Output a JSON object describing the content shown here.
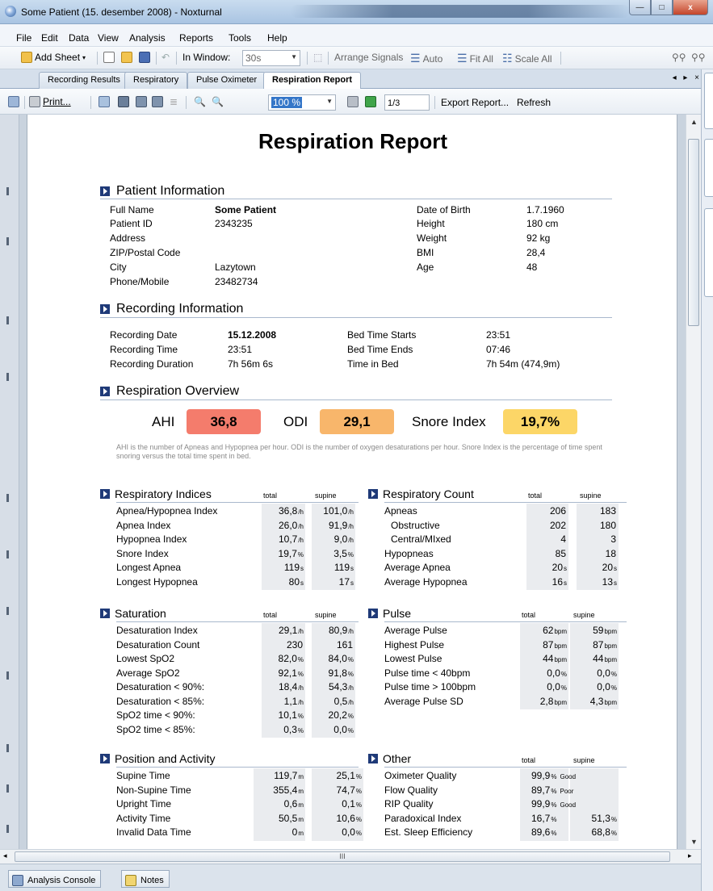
{
  "window": {
    "title": "Some Patient (15. desember 2008)  - Noxturnal",
    "min": "—",
    "max": "□",
    "close": "x"
  },
  "menu": [
    "File",
    "Edit",
    "Data",
    "View",
    "Analysis",
    "Reports",
    "Tools",
    "Help"
  ],
  "toolbar": {
    "add_sheet": "Add Sheet",
    "in_window_label": "In Window:",
    "in_window_value": "30s",
    "arrange_signals": "Arrange Signals",
    "auto": "Auto",
    "fit_all": "Fit All",
    "scale_all": "Scale All"
  },
  "tabs": [
    "Recording Results",
    "Respiratory",
    "Pulse Oximeter",
    "Respiration Report"
  ],
  "tab_controls": "◂ ▸ ×",
  "report_toolbar": {
    "print": "Print...",
    "zoom": "100 %",
    "page": "1/3",
    "export": "Export Report...",
    "refresh": "Refresh"
  },
  "report": {
    "title": "Respiration Report",
    "patient": {
      "heading": "Patient Information",
      "left": [
        {
          "label": "Full Name",
          "value": "Some Patient"
        },
        {
          "label": "Patient ID",
          "value": "2343235"
        },
        {
          "label": "Address",
          "value": ""
        },
        {
          "label": "ZIP/Postal Code",
          "value": ""
        },
        {
          "label": "City",
          "value": "Lazytown"
        },
        {
          "label": "Phone/Mobile",
          "value": "23482734"
        }
      ],
      "right": [
        {
          "label": "Date of Birth",
          "value": "1.7.1960"
        },
        {
          "label": "Height",
          "value": "180 cm"
        },
        {
          "label": "Weight",
          "value": "92 kg"
        },
        {
          "label": "BMI",
          "value": "28,4"
        },
        {
          "label": "Age",
          "value": "48"
        }
      ]
    },
    "recording": {
      "heading": "Recording Information",
      "left": [
        {
          "label": "Recording Date",
          "value": "15.12.2008"
        },
        {
          "label": "Recording Time",
          "value": "23:51"
        },
        {
          "label": "Recording Duration",
          "value": "7h 56m 6s"
        }
      ],
      "right": [
        {
          "label": "Bed Time Starts",
          "value": "23:51"
        },
        {
          "label": "Bed Time Ends",
          "value": "07:46"
        },
        {
          "label": "Time in Bed",
          "value": "7h 54m (474,9m)"
        }
      ]
    },
    "overview": {
      "heading": "Respiration Overview",
      "ahi_label": "AHI",
      "ahi": "36,8",
      "ahi_color": "#f47c6c",
      "odi_label": "ODI",
      "odi": "29,1",
      "odi_color": "#f8b66b",
      "snore_label": "Snore Index",
      "snore": "19,7%",
      "snore_color": "#fcd667",
      "note": "AHI is the number of Apneas and Hypopnea per hour. ODI is the number of oxygen desaturations per hour. Snore Index is the percentage of time spent snoring  versus the total time spent in bed."
    },
    "col_total": "total",
    "col_supine": "supine",
    "resp_indices": {
      "heading": "Respiratory Indices",
      "rows": [
        {
          "label": "Apnea/Hypopnea Index",
          "total": "36,8",
          "tu": "/h",
          "supine": "101,0",
          "su": "/h"
        },
        {
          "label": "Apnea Index",
          "total": "26,0",
          "tu": "/h",
          "supine": "91,9",
          "su": "/h"
        },
        {
          "label": "Hypopnea Index",
          "total": "10,7",
          "tu": "/h",
          "supine": "9,0",
          "su": "/h"
        },
        {
          "label": "Snore Index",
          "total": "19,7",
          "tu": "%",
          "supine": "3,5",
          "su": "%"
        },
        {
          "label": "Longest Apnea",
          "total": "119",
          "tu": "s",
          "supine": "119",
          "su": "s"
        },
        {
          "label": "Longest Hypopnea",
          "total": "80",
          "tu": "s",
          "supine": "17",
          "su": "s"
        }
      ]
    },
    "resp_count": {
      "heading": "Respiratory Count",
      "rows": [
        {
          "label": "Apneas",
          "total": "206",
          "tu": "",
          "supine": "183",
          "su": ""
        },
        {
          "label": "Obstructive",
          "total": "202",
          "tu": "",
          "supine": "180",
          "su": ""
        },
        {
          "label": "Central/MIxed",
          "total": "4",
          "tu": "",
          "supine": "3",
          "su": ""
        },
        {
          "label": "Hypopneas",
          "total": "85",
          "tu": "",
          "supine": "18",
          "su": ""
        },
        {
          "label": "Average Apnea",
          "total": "20",
          "tu": "s",
          "supine": "20",
          "su": "s"
        },
        {
          "label": "Average Hypopnea",
          "total": "16",
          "tu": "s",
          "supine": "13",
          "su": "s"
        }
      ]
    },
    "saturation": {
      "heading": "Saturation",
      "rows": [
        {
          "label": "Desaturation Index",
          "total": "29,1",
          "tu": "/h",
          "supine": "80,9",
          "su": "/h"
        },
        {
          "label": "Desaturation Count",
          "total": "230",
          "tu": "",
          "supine": "161",
          "su": ""
        },
        {
          "label": "Lowest SpO2",
          "total": "82,0",
          "tu": "%",
          "supine": "84,0",
          "su": "%"
        },
        {
          "label": "Average SpO2",
          "total": "92,1",
          "tu": "%",
          "supine": "91,8",
          "su": "%"
        },
        {
          "label": "Desaturation < 90%:",
          "total": "18,4",
          "tu": "/h",
          "supine": "54,3",
          "su": "/h"
        },
        {
          "label": "Desaturation < 85%:",
          "total": "1,1",
          "tu": "/h",
          "supine": "0,5",
          "su": "/h"
        },
        {
          "label": "SpO2 time < 90%:",
          "total": "10,1",
          "tu": "%",
          "supine": "20,2",
          "su": "%"
        },
        {
          "label": "SpO2 time < 85%:",
          "total": "0,3",
          "tu": "%",
          "supine": "0,0",
          "su": "%"
        }
      ]
    },
    "pulse": {
      "heading": "Pulse",
      "rows": [
        {
          "label": "Average Pulse",
          "total": "62",
          "tu": "bpm",
          "supine": "59",
          "su": "bpm"
        },
        {
          "label": "Highest Pulse",
          "total": "87",
          "tu": "bpm",
          "supine": "87",
          "su": "bpm"
        },
        {
          "label": "Lowest Pulse",
          "total": "44",
          "tu": "bpm",
          "supine": "44",
          "su": "bpm"
        },
        {
          "label": "Pulse time < 40bpm",
          "total": "0,0",
          "tu": "%",
          "supine": "0,0",
          "su": "%"
        },
        {
          "label": "Pulse time > 100bpm",
          "total": "0,0",
          "tu": "%",
          "supine": "0,0",
          "su": "%"
        },
        {
          "label": "Average Pulse SD",
          "total": "2,8",
          "tu": "bpm",
          "supine": "4,3",
          "su": "bpm"
        }
      ]
    },
    "position": {
      "heading": "Position and Activity",
      "rows": [
        {
          "label": "Supine Time",
          "total": "119,7",
          "tu": "m",
          "supine": "25,1",
          "su": "%"
        },
        {
          "label": "Non-Supine Time",
          "total": "355,4",
          "tu": "m",
          "supine": "74,7",
          "su": "%"
        },
        {
          "label": "Upright Time",
          "total": "0,6",
          "tu": "m",
          "supine": "0,1",
          "su": "%"
        },
        {
          "label": "Activity Time",
          "total": "50,5",
          "tu": "m",
          "supine": "10,6",
          "su": "%"
        },
        {
          "label": "Invalid Data Time",
          "total": "0",
          "tu": "m",
          "supine": "0,0",
          "su": "%"
        }
      ]
    },
    "other": {
      "heading": "Other",
      "rows": [
        {
          "label": "Oximeter Quality",
          "total": "99,9",
          "tu": "%",
          "q": "Good",
          "supine": "",
          "su": ""
        },
        {
          "label": "Flow Quality",
          "total": "89,7",
          "tu": "%",
          "q": "Poor",
          "supine": "",
          "su": ""
        },
        {
          "label": "RIP Quality",
          "total": "99,9",
          "tu": "%",
          "q": "Good",
          "supine": "",
          "su": ""
        },
        {
          "label": "Paradoxical Index",
          "total": "16,7",
          "tu": "%",
          "q": "",
          "supine": "51,3",
          "su": "%"
        },
        {
          "label": "Est. Sleep Efficiency",
          "total": "89,6",
          "tu": "%",
          "q": "",
          "supine": "68,8",
          "su": "%"
        }
      ]
    }
  },
  "hscroll_grip": "III",
  "bottom_tabs": [
    "Analysis Console",
    "Notes"
  ]
}
